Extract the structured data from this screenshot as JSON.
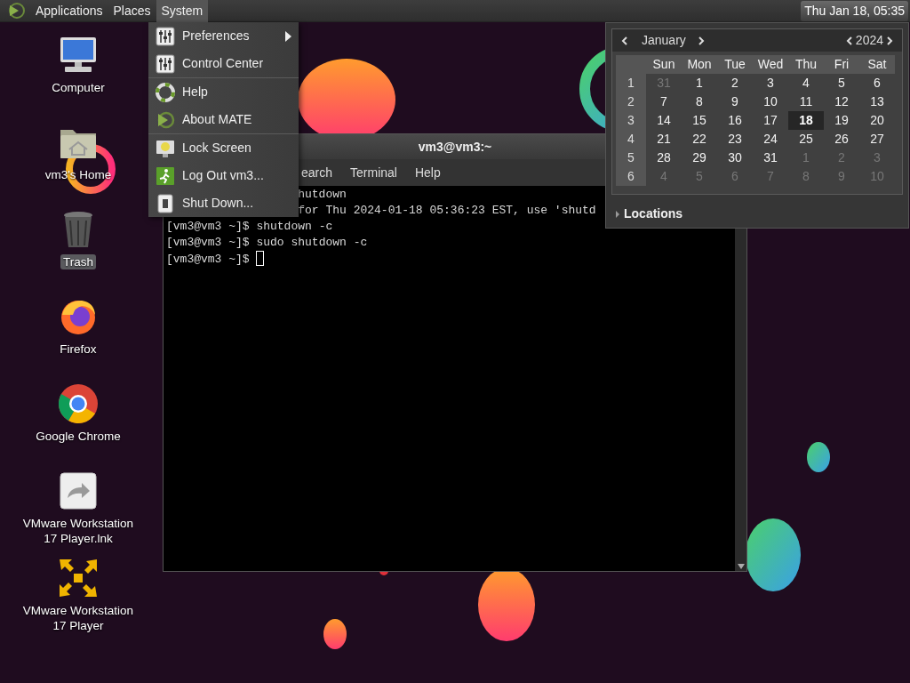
{
  "panel": {
    "menus": [
      {
        "label": "Applications",
        "selected": false
      },
      {
        "label": "Places",
        "selected": false
      },
      {
        "label": "System",
        "selected": true
      }
    ],
    "clock": {
      "label": "Thu Jan 18, 05:35",
      "selected": true
    }
  },
  "desktop_icons": [
    {
      "label": "Computer",
      "kind": "computer",
      "selected": false
    },
    {
      "label": "vm3's Home",
      "kind": "home",
      "selected": false
    },
    {
      "label": "Trash",
      "kind": "trash",
      "selected": true
    },
    {
      "label": "Firefox",
      "kind": "firefox",
      "selected": false
    },
    {
      "label": "Google Chrome",
      "kind": "chrome",
      "selected": false
    },
    {
      "label": "VMware Workstation 17 Player.lnk",
      "kind": "shortcut",
      "selected": false
    },
    {
      "label": "VMware Workstation 17 Player",
      "kind": "vmware",
      "selected": false
    }
  ],
  "terminal": {
    "title": "vm3@vm3:~",
    "menu": [
      "earch",
      "Terminal",
      "Help"
    ],
    "lines": [
      {
        "kind": "covered",
        "text": "hutdown"
      },
      {
        "kind": "covered",
        "text": "for Thu 2024-01-18 05:36:23 EST, use 'shutd"
      },
      {
        "kind": "plain",
        "text": "[vm3@vm3 ~]$ shutdown -c"
      },
      {
        "kind": "plain",
        "text": "[vm3@vm3 ~]$ sudo shutdown -c"
      },
      {
        "kind": "cursor",
        "text": "[vm3@vm3 ~]$ "
      }
    ]
  },
  "system_menu": {
    "groups": [
      [
        {
          "label": "Preferences",
          "kind": "preferences",
          "submenu": true
        },
        {
          "label": "Control Center",
          "kind": "preferences",
          "submenu": false
        }
      ],
      [
        {
          "label": "Help",
          "kind": "help",
          "submenu": false
        },
        {
          "label": "About MATE",
          "kind": "mate",
          "submenu": false
        }
      ],
      [
        {
          "label": "Lock Screen",
          "kind": "lock",
          "submenu": false
        },
        {
          "label": "Log Out vm3...",
          "kind": "logout",
          "submenu": false
        },
        {
          "label": "Shut Down...",
          "kind": "shutdown",
          "submenu": false
        }
      ]
    ]
  },
  "calendar": {
    "month": "January",
    "year": "2024",
    "weekdays": [
      "Sun",
      "Mon",
      "Tue",
      "Wed",
      "Thu",
      "Fri",
      "Sat"
    ],
    "weeks": [
      {
        "number": "1",
        "days": [
          {
            "label": "31",
            "other_month": true,
            "selected": false
          },
          {
            "label": "1",
            "other_month": false,
            "selected": false
          },
          {
            "label": "2",
            "other_month": false,
            "selected": false
          },
          {
            "label": "3",
            "other_month": false,
            "selected": false
          },
          {
            "label": "4",
            "other_month": false,
            "selected": false
          },
          {
            "label": "5",
            "other_month": false,
            "selected": false
          },
          {
            "label": "6",
            "other_month": false,
            "selected": false
          }
        ]
      },
      {
        "number": "2",
        "days": [
          {
            "label": "7",
            "other_month": false,
            "selected": false
          },
          {
            "label": "8",
            "other_month": false,
            "selected": false
          },
          {
            "label": "9",
            "other_month": false,
            "selected": false
          },
          {
            "label": "10",
            "other_month": false,
            "selected": false
          },
          {
            "label": "11",
            "other_month": false,
            "selected": false
          },
          {
            "label": "12",
            "other_month": false,
            "selected": false
          },
          {
            "label": "13",
            "other_month": false,
            "selected": false
          }
        ]
      },
      {
        "number": "3",
        "days": [
          {
            "label": "14",
            "other_month": false,
            "selected": false
          },
          {
            "label": "15",
            "other_month": false,
            "selected": false
          },
          {
            "label": "16",
            "other_month": false,
            "selected": false
          },
          {
            "label": "17",
            "other_month": false,
            "selected": false
          },
          {
            "label": "18",
            "other_month": false,
            "selected": true
          },
          {
            "label": "19",
            "other_month": false,
            "selected": false
          },
          {
            "label": "20",
            "other_month": false,
            "selected": false
          }
        ]
      },
      {
        "number": "4",
        "days": [
          {
            "label": "21",
            "other_month": false,
            "selected": false
          },
          {
            "label": "22",
            "other_month": false,
            "selected": false
          },
          {
            "label": "23",
            "other_month": false,
            "selected": false
          },
          {
            "label": "24",
            "other_month": false,
            "selected": false
          },
          {
            "label": "25",
            "other_month": false,
            "selected": false
          },
          {
            "label": "26",
            "other_month": false,
            "selected": false
          },
          {
            "label": "27",
            "other_month": false,
            "selected": false
          }
        ]
      },
      {
        "number": "5",
        "days": [
          {
            "label": "28",
            "other_month": false,
            "selected": false
          },
          {
            "label": "29",
            "other_month": false,
            "selected": false
          },
          {
            "label": "30",
            "other_month": false,
            "selected": false
          },
          {
            "label": "31",
            "other_month": false,
            "selected": false
          },
          {
            "label": "1",
            "other_month": true,
            "selected": false
          },
          {
            "label": "2",
            "other_month": true,
            "selected": false
          },
          {
            "label": "3",
            "other_month": true,
            "selected": false
          }
        ]
      },
      {
        "number": "6",
        "days": [
          {
            "label": "4",
            "other_month": true,
            "selected": false
          },
          {
            "label": "5",
            "other_month": true,
            "selected": false
          },
          {
            "label": "6",
            "other_month": true,
            "selected": false
          },
          {
            "label": "7",
            "other_month": true,
            "selected": false
          },
          {
            "label": "8",
            "other_month": true,
            "selected": false
          },
          {
            "label": "9",
            "other_month": true,
            "selected": false
          },
          {
            "label": "10",
            "other_month": true,
            "selected": false
          }
        ]
      }
    ],
    "locations": {
      "label": "Locations",
      "expanded": false
    }
  }
}
